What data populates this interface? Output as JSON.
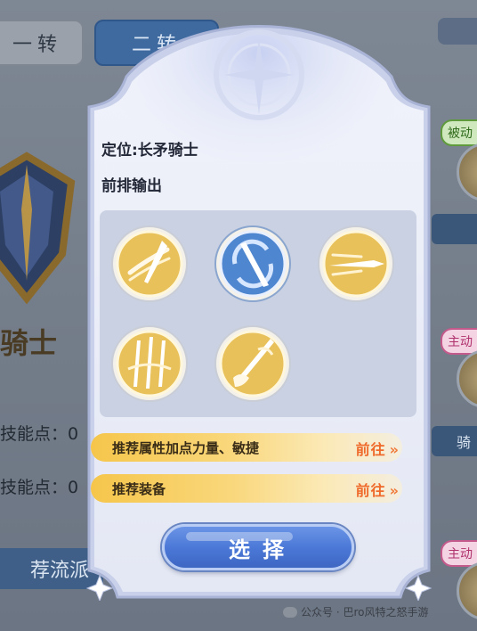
{
  "background": {
    "tabs": [
      "一转",
      "二转"
    ],
    "class_name_fragment": "骑士",
    "skill_points": [
      "技能点：0",
      "技能点：0"
    ],
    "section_label": "荐流派",
    "side_tags": [
      "被动",
      "主动",
      "主动"
    ],
    "side_button_char": "骑"
  },
  "dialog": {
    "role": "定位:长矛骑士",
    "position": "前排输出",
    "skills": [
      {
        "icon": "spear-sweep-skill-icon",
        "style": "gold"
      },
      {
        "icon": "spear-whirl-skill-icon",
        "style": "blue"
      },
      {
        "icon": "spear-thrust-skill-icon",
        "style": "gold"
      },
      {
        "icon": "triple-spear-skill-icon",
        "style": "gold"
      },
      {
        "icon": "spear-grip-skill-icon",
        "style": "gold"
      }
    ],
    "recommendations": [
      {
        "label": "推荐属性加点力量、敏捷",
        "action": "前往",
        "chevron": "»"
      },
      {
        "label": "推荐装备",
        "action": "前往",
        "chevron": "»"
      }
    ],
    "select_button": "选择"
  },
  "watermark": "公众号 · 巴ro风特之怒手游",
  "colors": {
    "accent_gold": "#f6c64b",
    "goto_orange": "#ef6a2a",
    "select_blue": "#4a77d6",
    "selected_skill_blue": "#4f86d0"
  }
}
